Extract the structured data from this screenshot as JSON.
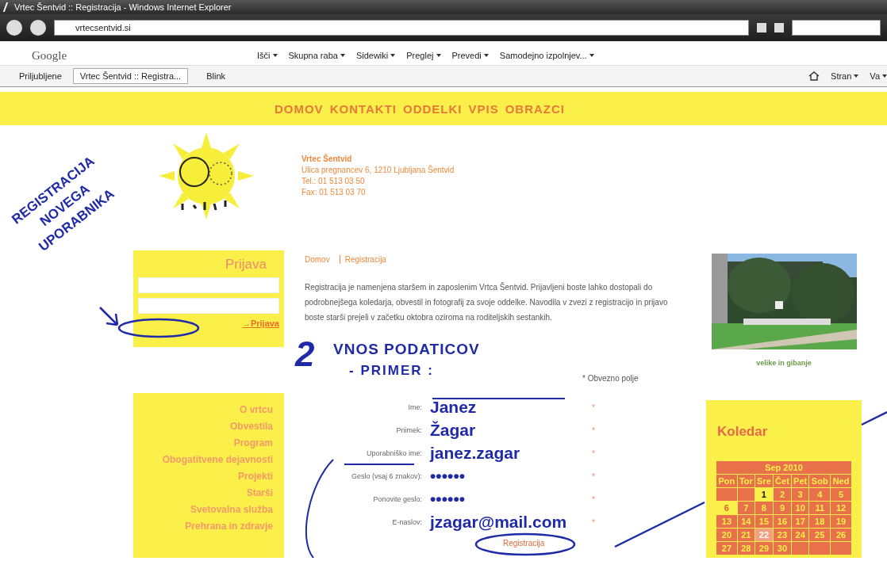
{
  "window": {
    "title": "Vrtec Šentvid :: Registracija - Windows Internet Explorer"
  },
  "address_bar": {
    "url": "vrtecsentvid.si"
  },
  "google_toolbar": {
    "logo": "Google",
    "items": [
      "Išči",
      "Skupna raba",
      "Sidewiki",
      "Preglej",
      "Prevedi",
      "Samodejno izpolnjev..."
    ]
  },
  "favorites_bar": {
    "favorites": "Priljubljene",
    "tabs": [
      {
        "label": "Vrtec Šentvid :: Registra...",
        "selected": true
      },
      {
        "label": "Blink",
        "selected": false
      }
    ],
    "commands": [
      "Stran",
      "Va"
    ]
  },
  "site": {
    "nav": [
      "DOMOV",
      "KONTAKTI",
      "ODDELKI",
      "VPIS",
      "OBRAZCI"
    ],
    "contact": {
      "name": "Vrtec Šentvid",
      "lines": [
        "Ulica pregnancev 6, 1210 Ljubljana Šentvid",
        "Tel.: 01 513 03 50",
        "Fax: 01 513 03 70"
      ]
    },
    "breadcrumb": [
      "Domov",
      "Registracija"
    ],
    "intro": "Registracija je namenjena staršem in zaposlenim Vrtca Šentvid. Prijavljeni boste lahko dostopali do podrobnejšega koledarja, obvestil in fotografij za svoje oddelke. Navodila v zvezi z registracijo in prijavo boste starši prejeli v začetku oktobra oziroma na roditeljskih sestankih.",
    "login": {
      "title": "Prijava",
      "link": "→Prijava"
    },
    "menu": [
      "O vrtcu",
      "Obvestila",
      "Program",
      "Obogatitvene dejavnosti",
      "Projekti",
      "Starši",
      "Svetovalna služba",
      "Prehrana in zdravje"
    ],
    "form": {
      "required_note": "* Obvezno polje",
      "fields": [
        {
          "label": "Ime:",
          "value": "Janez",
          "marker": "*"
        },
        {
          "label": "Priimek:",
          "value": "Žagar",
          "marker": "*"
        },
        {
          "label": "Uporabniško ime:",
          "value": "janez.zagar",
          "marker": "*"
        },
        {
          "label": "Geslo (vsaj 6 znakov):",
          "value": "••••••",
          "marker": "*"
        },
        {
          "label": "Ponovite geslo:",
          "value": "••••••",
          "marker": "*"
        },
        {
          "label": "E-naslov:",
          "value": "jzagar@mail.com",
          "marker": "*"
        }
      ],
      "submit": "Registracija"
    },
    "photo": {
      "kind": "picture",
      "caption": "velike in gibanje"
    },
    "calendar": {
      "title": "Koledar",
      "month": "Sep 2010",
      "weekdays": [
        "Pon",
        "Tor",
        "Sre",
        "Čet",
        "Pet",
        "Sob",
        "Ned"
      ],
      "weeks": [
        [
          {
            "kind": "blank"
          },
          {
            "kind": "blank"
          },
          {
            "day": "1",
            "kind": "event"
          },
          {
            "day": "2",
            "kind": "plain"
          },
          {
            "day": "3",
            "kind": "plain"
          },
          {
            "day": "4",
            "kind": "plain"
          },
          {
            "day": "5",
            "kind": "plain"
          }
        ],
        [
          {
            "day": "6",
            "kind": "holiday"
          },
          {
            "day": "7",
            "kind": "plain"
          },
          {
            "day": "8",
            "kind": "plain"
          },
          {
            "day": "9",
            "kind": "plain"
          },
          {
            "day": "10",
            "kind": "plain"
          },
          {
            "day": "11",
            "kind": "plain"
          },
          {
            "day": "12",
            "kind": "plain"
          }
        ],
        [
          {
            "day": "13",
            "kind": "plain"
          },
          {
            "day": "14",
            "kind": "plain"
          },
          {
            "day": "15",
            "kind": "plain"
          },
          {
            "day": "16",
            "kind": "plain"
          },
          {
            "day": "17",
            "kind": "plain"
          },
          {
            "day": "18",
            "kind": "plain"
          },
          {
            "day": "19",
            "kind": "plain"
          }
        ],
        [
          {
            "day": "20",
            "kind": "plain"
          },
          {
            "day": "21",
            "kind": "plain"
          },
          {
            "day": "22",
            "kind": "today"
          },
          {
            "day": "23",
            "kind": "plain"
          },
          {
            "day": "24",
            "kind": "plain"
          },
          {
            "day": "25",
            "kind": "plain"
          },
          {
            "day": "26",
            "kind": "plain"
          }
        ],
        [
          {
            "day": "27",
            "kind": "plain"
          },
          {
            "day": "28",
            "kind": "plain"
          },
          {
            "day": "29",
            "kind": "plain"
          },
          {
            "day": "30",
            "kind": "plain"
          },
          {
            "kind": "blank"
          },
          {
            "kind": "blank"
          },
          {
            "kind": "blank"
          }
        ]
      ]
    }
  },
  "annotations": {
    "side_note": [
      "REGISTRACIJA",
      "NOVEGA",
      "UPORABNIKA"
    ],
    "step_number": "2",
    "step_title": "VNOS PODATICOV",
    "step_subtitle": "- PRIMER :"
  }
}
